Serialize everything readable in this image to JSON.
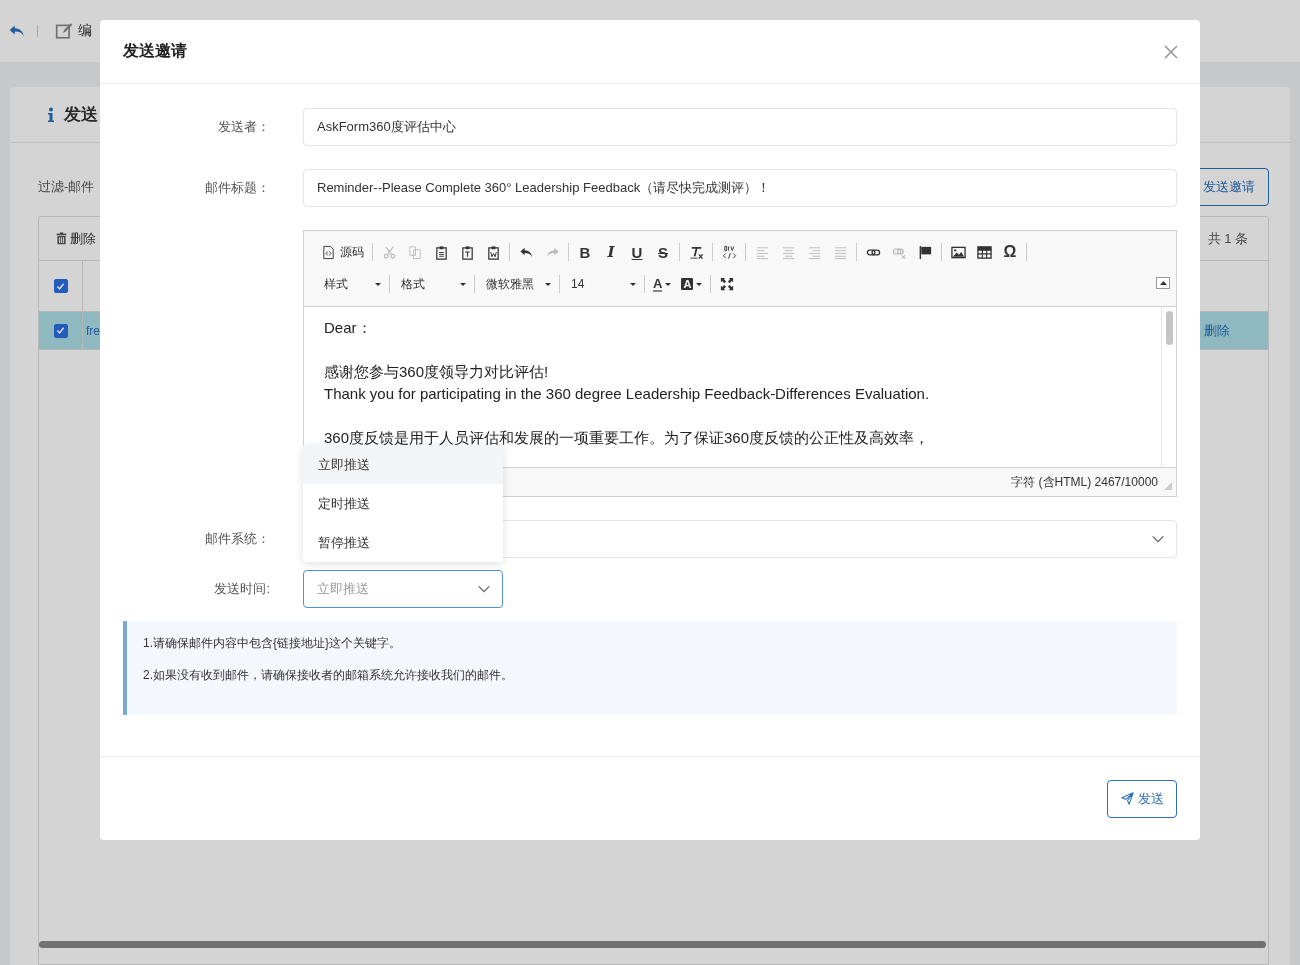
{
  "background": {
    "toolbar": {
      "edit_label": "编"
    },
    "card": {
      "title": "发送",
      "filter_label": "过滤-邮件",
      "invite_button": "发送邀请",
      "table": {
        "delete_button": "删除",
        "total": "共 1 条",
        "header_checked": true,
        "rows": [
          {
            "selected": true,
            "checked": true,
            "cell": "fre",
            "action": "删除"
          }
        ]
      }
    }
  },
  "dialog": {
    "title": "发送邀请",
    "sender": {
      "label": "发送者：",
      "value": "AskForm360度评估中心"
    },
    "subject": {
      "label": "邮件标题：",
      "value": "Reminder--Please Complete 360° Leadership Feedback（请尽快完成测评）！"
    },
    "editor": {
      "toolbar_row1": [
        {
          "kind": "source",
          "label": "源码",
          "disabled": false
        },
        {
          "kind": "separator"
        },
        {
          "kind": "cut",
          "disabled": true
        },
        {
          "kind": "copy",
          "disabled": true
        },
        {
          "kind": "paste",
          "disabled": false
        },
        {
          "kind": "paste-text",
          "disabled": false
        },
        {
          "kind": "paste-word",
          "disabled": false
        },
        {
          "kind": "separator"
        },
        {
          "kind": "undo",
          "disabled": false
        },
        {
          "kind": "redo",
          "disabled": true
        },
        {
          "kind": "separator"
        },
        {
          "kind": "bold",
          "glyph": "B",
          "disabled": false
        },
        {
          "kind": "italic",
          "glyph": "I",
          "disabled": false
        },
        {
          "kind": "underline",
          "glyph": "U",
          "disabled": false
        },
        {
          "kind": "strike",
          "glyph": "S",
          "disabled": false
        },
        {
          "kind": "separator"
        },
        {
          "kind": "remove-format",
          "disabled": false
        },
        {
          "kind": "separator"
        },
        {
          "kind": "div",
          "disabled": false
        },
        {
          "kind": "separator"
        },
        {
          "kind": "align-left",
          "disabled": true
        },
        {
          "kind": "align-center",
          "disabled": true
        },
        {
          "kind": "align-right",
          "disabled": true
        },
        {
          "kind": "align-justify",
          "disabled": true
        },
        {
          "kind": "separator"
        },
        {
          "kind": "link",
          "disabled": false
        },
        {
          "kind": "unlink",
          "disabled": true
        },
        {
          "kind": "anchor",
          "disabled": false
        },
        {
          "kind": "separator"
        },
        {
          "kind": "image",
          "disabled": false
        },
        {
          "kind": "table",
          "disabled": false
        },
        {
          "kind": "special-char",
          "glyph": "Ω",
          "disabled": false
        },
        {
          "kind": "separator"
        }
      ],
      "combos": [
        {
          "label": "样式"
        },
        {
          "label": "格式"
        },
        {
          "label": "微软雅黑"
        },
        {
          "label": "14"
        }
      ],
      "text_color": {
        "glyph": "A"
      },
      "bg_color": {
        "glyph": "A"
      },
      "content": [
        [
          "Dear："
        ],
        [
          "感谢您参与360度领导力对比评估!",
          "Thank you for participating in the 360 degree Leadership Feedback-Differences Evaluation."
        ],
        [
          "360度反馈是用于人员评估和发展的一项重要工作。为了保证360度反馈的公正性及高效率，"
        ]
      ],
      "status": "字符 (含HTML) 2467/10000"
    },
    "mail_system": {
      "label": "邮件系统："
    },
    "send_time": {
      "label": "发送时间:",
      "value": "立即推送",
      "expanded": true,
      "options": [
        {
          "label": "立即推送",
          "selected": true
        },
        {
          "label": "定时推送",
          "selected": false
        },
        {
          "label": "暂停推送",
          "selected": false
        }
      ]
    },
    "notices": [
      "1.请确保邮件内容中包含{链接地址}这个关键字。",
      "2.如果没有收到邮件，请确保接收者的邮箱系统允许接收我们的邮件。"
    ],
    "send_button": "发送"
  }
}
